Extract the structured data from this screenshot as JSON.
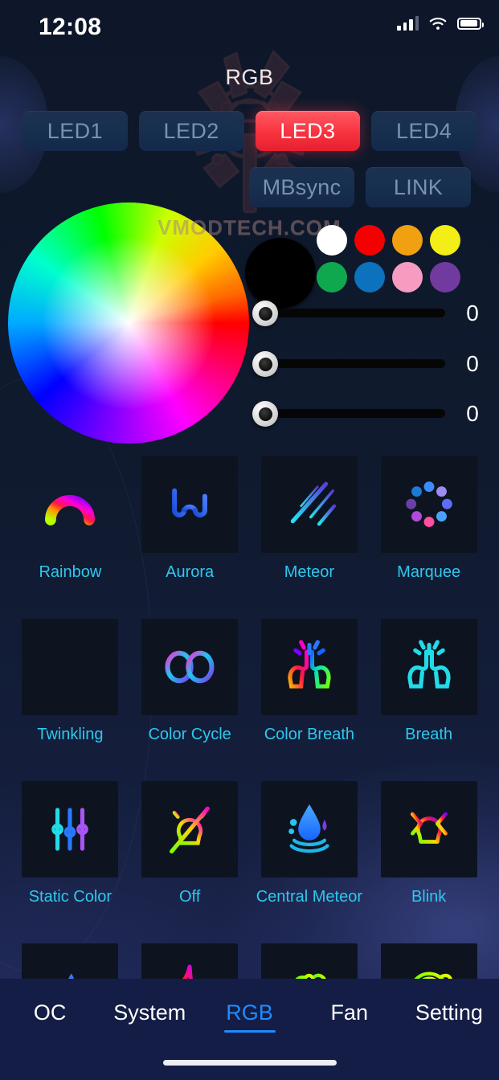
{
  "status_bar": {
    "time": "12:08",
    "signal_icon": "cellular-signal-icon",
    "wifi_icon": "wifi-icon",
    "battery_icon": "battery-icon"
  },
  "header": {
    "title": "RGB",
    "background_emblem": "mechanical-emblem-watermark"
  },
  "watermark": {
    "text": "VMODTECH.COM"
  },
  "led_zones": {
    "buttons": [
      {
        "label": "LED1",
        "active": false
      },
      {
        "label": "LED2",
        "active": false
      },
      {
        "label": "LED3",
        "active": true
      },
      {
        "label": "LED4",
        "active": false
      }
    ],
    "sync_buttons": [
      {
        "label": "MBsync",
        "active": false
      },
      {
        "label": "LINK",
        "active": false
      }
    ],
    "active_color": "#f8323f",
    "inactive_color": "#17304f"
  },
  "color_picker": {
    "wheel_icon": "hsv-color-wheel",
    "preview_color": "#000000",
    "swatches": [
      {
        "name": "white",
        "color": "#ffffff"
      },
      {
        "name": "red",
        "color": "#f50000"
      },
      {
        "name": "orange",
        "color": "#f0a010"
      },
      {
        "name": "yellow",
        "color": "#f2ee16"
      },
      {
        "name": "green",
        "color": "#10a84e"
      },
      {
        "name": "blue",
        "color": "#0c72bd"
      },
      {
        "name": "pink",
        "color": "#f79bc0"
      },
      {
        "name": "purple",
        "color": "#713a9e"
      }
    ]
  },
  "sliders": [
    {
      "name": "red-slider",
      "value": "0",
      "position_pct": 0
    },
    {
      "name": "green-slider",
      "value": "0",
      "position_pct": 0
    },
    {
      "name": "blue-slider",
      "value": "0",
      "position_pct": 0
    }
  ],
  "effects": {
    "rows": [
      [
        {
          "label": "Rainbow",
          "icon": "rainbow-arc-icon",
          "tile": "plain"
        },
        {
          "label": "Aurora",
          "icon": "aurora-wave-icon",
          "tile": "dark"
        },
        {
          "label": "Meteor",
          "icon": "meteor-streaks-icon",
          "tile": "dark"
        },
        {
          "label": "Marquee",
          "icon": "marquee-dots-icon",
          "tile": "dark"
        }
      ],
      [
        {
          "label": "Twinkling",
          "icon": "twinkling-bars-icon",
          "tile": "dark"
        },
        {
          "label": "Color Cycle",
          "icon": "infinity-loop-icon",
          "tile": "dark"
        },
        {
          "label": "Color Breath",
          "icon": "lungs-color-icon",
          "tile": "dark"
        },
        {
          "label": "Breath",
          "icon": "lungs-cyan-icon",
          "tile": "dark"
        }
      ],
      [
        {
          "label": "Static Color",
          "icon": "sliders-icon",
          "tile": "dark"
        },
        {
          "label": "Off",
          "icon": "bulb-off-icon",
          "tile": "dark"
        },
        {
          "label": "Central Meteor",
          "icon": "water-drop-icon",
          "tile": "dark"
        },
        {
          "label": "Blink",
          "icon": "bulb-blink-icon",
          "tile": "dark"
        }
      ],
      [
        {
          "label": "",
          "icon": "water-splash-icon",
          "tile": "dark"
        },
        {
          "label": "",
          "icon": "flame-icon",
          "tile": "dark"
        },
        {
          "label": "",
          "icon": "trees-icon",
          "tile": "dark"
        },
        {
          "label": "",
          "icon": "planet-icon",
          "tile": "dark"
        }
      ]
    ]
  },
  "tab_bar": {
    "tabs": [
      {
        "label": "OC",
        "active": false
      },
      {
        "label": "System",
        "active": false
      },
      {
        "label": "RGB",
        "active": true
      },
      {
        "label": "Fan",
        "active": false
      },
      {
        "label": "Setting",
        "active": false
      }
    ],
    "active_color": "#1f8cff"
  }
}
